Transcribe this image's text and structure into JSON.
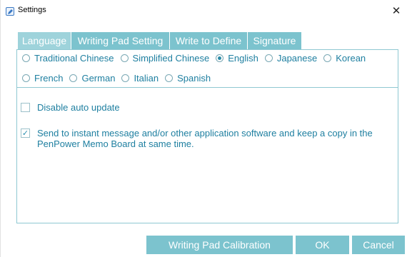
{
  "window": {
    "title": "Settings",
    "close_glyph": "✕"
  },
  "tabs": [
    {
      "label": "Language",
      "active": true
    },
    {
      "label": "Writing Pad Setting",
      "active": false
    },
    {
      "label": "Write to Define",
      "active": false
    },
    {
      "label": "Signature",
      "active": false
    }
  ],
  "languages": [
    {
      "label": "Traditional Chinese",
      "selected": false
    },
    {
      "label": "Simplified Chinese",
      "selected": false
    },
    {
      "label": "English",
      "selected": true
    },
    {
      "label": "Japanese",
      "selected": false
    },
    {
      "label": "Korean",
      "selected": false
    },
    {
      "label": "French",
      "selected": false
    },
    {
      "label": "German",
      "selected": false
    },
    {
      "label": "Italian",
      "selected": false
    },
    {
      "label": "Spanish",
      "selected": false
    }
  ],
  "options": {
    "disable_auto_update": {
      "label": "Disable auto update",
      "checked": false
    },
    "send_to_im": {
      "label": "Send to instant message and/or other application software and keep a copy in the",
      "label_line2": "PenPower Memo Board at same time.",
      "checked": true
    }
  },
  "buttons": {
    "calibration": "Writing Pad Calibration",
    "ok": "OK",
    "cancel": "Cancel"
  },
  "colors": {
    "accent": "#7cc3ce",
    "active_tab": "#9ed3db",
    "text": "#1e7fa0"
  },
  "icons": {
    "app": "pen-app-icon",
    "close": "close-icon",
    "check": "checkmark-icon"
  }
}
